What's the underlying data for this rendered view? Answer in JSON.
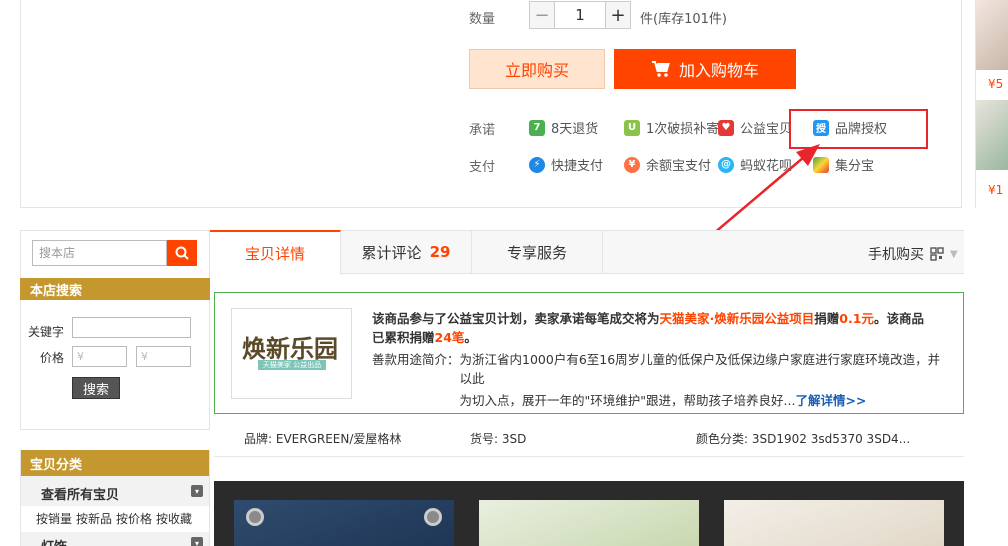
{
  "product": {
    "qty_label": "数量",
    "qty_value": "1",
    "minus": "−",
    "plus": "+",
    "stock": "件(库存101件)",
    "buy_now": "立即购买",
    "add_cart": "加入购物车"
  },
  "promise": {
    "label": "承诺",
    "items": [
      {
        "icon": "7-day-return-icon",
        "text": "8天退货",
        "color": "#4caf50"
      },
      {
        "icon": "breakage-compensation-icon",
        "text": "1次破损补寄",
        "color": "#8bc34a"
      },
      {
        "icon": "charity-icon",
        "text": "公益宝贝",
        "color": "#e53935"
      },
      {
        "icon": "brand-auth-icon",
        "text": "品牌授权",
        "color": "#2196f3"
      }
    ]
  },
  "payment": {
    "label": "支付",
    "items": [
      {
        "icon": "quick-pay-icon",
        "text": "快捷支付",
        "color": "#1e88e5"
      },
      {
        "icon": "yuebao-icon",
        "text": "余额宝支付",
        "color": "#ff7043"
      },
      {
        "icon": "huabei-icon",
        "text": "蚂蚁花呗",
        "color": "#29b6f6"
      },
      {
        "icon": "jifenbao-icon",
        "text": "集分宝",
        "color": "#43a047"
      }
    ]
  },
  "thumbs": {
    "price1": "¥5",
    "price2": "¥1"
  },
  "sidebar": {
    "store_search_placeholder": "搜本店",
    "store_search_title": "本店搜索",
    "keyword_label": "关键字",
    "price_label": "价格",
    "price_min_placeholder": "¥",
    "price_max_placeholder": "¥",
    "search_button": "搜索",
    "category_title": "宝贝分类",
    "view_all": "查看所有宝贝",
    "sort_links": [
      "按销量",
      "按新品",
      "按价格",
      "按收藏"
    ],
    "cat2": "灯饰"
  },
  "tabs": {
    "details": "宝贝详情",
    "reviews": "累计评论",
    "reviews_count": "29",
    "service": "专享服务",
    "mobile": "手机购买"
  },
  "charity": {
    "logo_text": "焕新乐园",
    "logo_sub": "天猫美家 公益出品",
    "line1_a": "该商品参与了公益宝贝计划，卖家承诺每笔成交将为",
    "line1_b": "天猫美家·焕新乐园公益项目",
    "line1_c": "捐赠",
    "line1_d": "0.1元",
    "line1_e": "。该商品",
    "line2_a": "已累积捐赠",
    "line2_b": "24笔",
    "line2_c": "。",
    "purpose_label": "善款用途简介：",
    "purpose_1": "为浙江省内1000户有6至16周岁儿童的低保户及低保边缘户家庭进行家庭环境改造，并以此",
    "purpose_2": "为切入点，展开一年的\"环境维护\"跟进，帮助孩子培养良好...",
    "more_link": "了解详情>>"
  },
  "attributes": {
    "brand": "品牌: EVERGREEN/爱屋格林",
    "sku": "货号: 3SD",
    "color": "颜色分类: 3SD1902 3sd5370 3SD4..."
  },
  "colors": {
    "accent": "#ff4400",
    "gold": "#c5982f",
    "highlight": "#e8242c",
    "green_border": "#4caf50"
  }
}
